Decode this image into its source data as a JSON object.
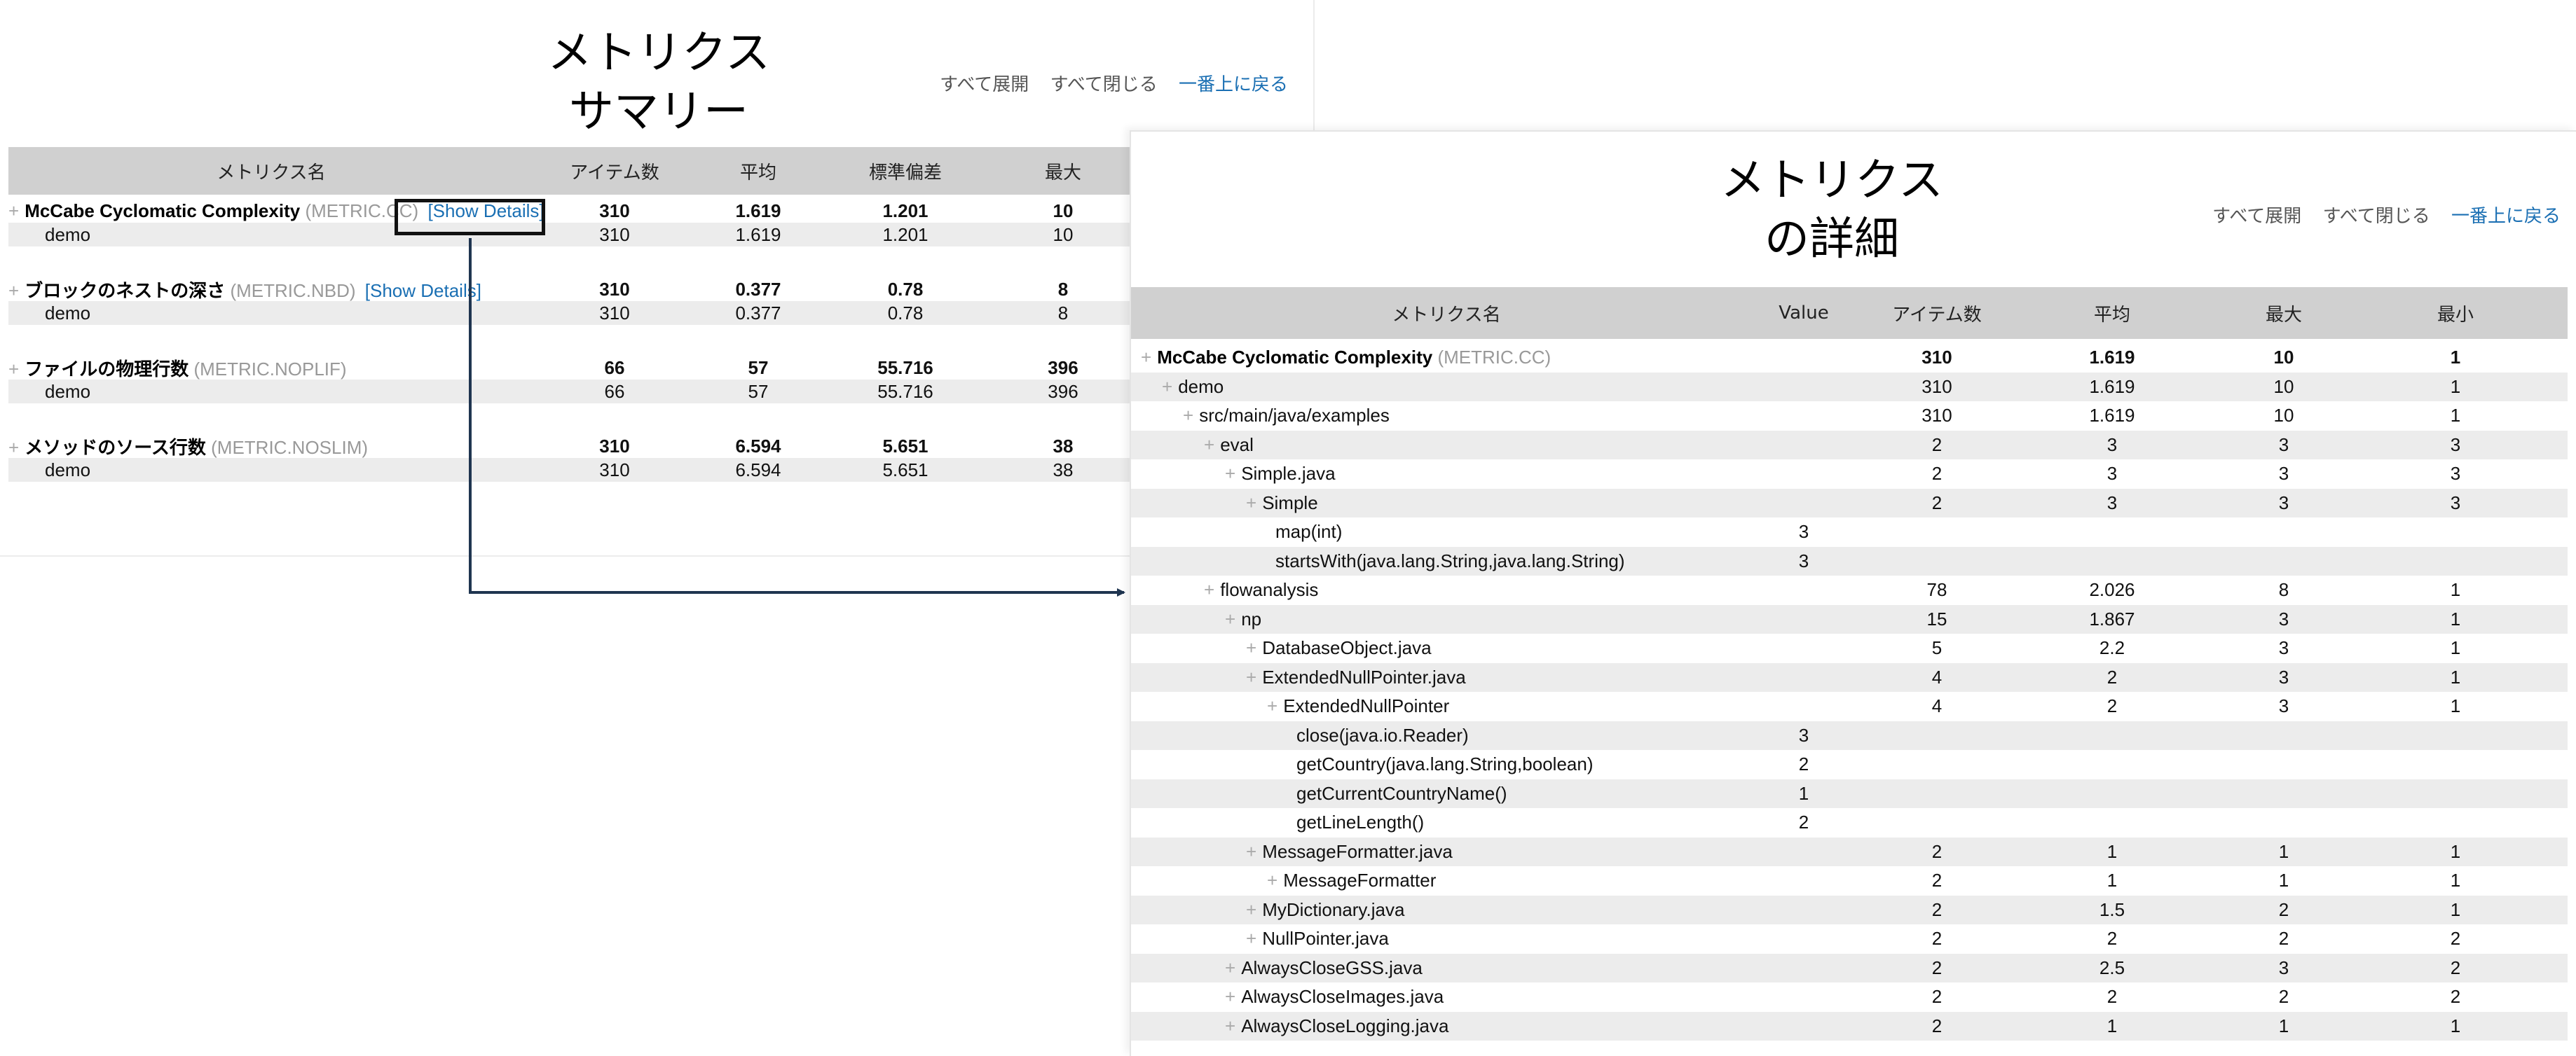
{
  "summary": {
    "title_line1": "メトリクス",
    "title_line2": "サマリー",
    "nav": {
      "expand_all": "すべて展開",
      "collapse_all": "すべて閉じる",
      "back_to_top": "一番上に戻る"
    },
    "headers": {
      "name": "メトリクス名",
      "items": "アイテム数",
      "avg": "平均",
      "std": "標準偏差",
      "max": "最大"
    },
    "show_details_label": "[Show Details]",
    "metrics": [
      {
        "name": "McCabe Cyclomatic Complexity",
        "code": "(METRIC.CC)",
        "items": "310",
        "avg": "1.619",
        "std": "1.201",
        "max": "10",
        "child": {
          "name": "demo",
          "items": "310",
          "avg": "1.619",
          "std": "1.201",
          "max": "10"
        }
      },
      {
        "name": "ブロックのネストの深さ",
        "code": "(METRIC.NBD)",
        "items": "310",
        "avg": "0.377",
        "std": "0.78",
        "max": "8",
        "child": {
          "name": "demo",
          "items": "310",
          "avg": "0.377",
          "std": "0.78",
          "max": "8"
        }
      },
      {
        "name": "ファイルの物理行数",
        "code": "(METRIC.NOPLIF)",
        "items": "66",
        "avg": "57",
        "std": "55.716",
        "max": "396",
        "child": {
          "name": "demo",
          "items": "66",
          "avg": "57",
          "std": "55.716",
          "max": "396"
        }
      },
      {
        "name": "メソッドのソース行数",
        "code": "(METRIC.NOSLIM)",
        "items": "310",
        "avg": "6.594",
        "std": "5.651",
        "max": "38",
        "child": {
          "name": "demo",
          "items": "310",
          "avg": "6.594",
          "std": "5.651",
          "max": "38"
        }
      }
    ]
  },
  "detail": {
    "title_line1": "メトリクス",
    "title_line2": "の詳細",
    "nav": {
      "expand_all": "すべて展開",
      "collapse_all": "すべて閉じる",
      "back_to_top": "一番上に戻る"
    },
    "headers": {
      "name": "メトリクス名",
      "value": "Value",
      "items": "アイテム数",
      "avg": "平均",
      "max": "最大",
      "min": "最小"
    },
    "metric_name": "McCabe Cyclomatic Complexity",
    "metric_code": "(METRIC.CC)",
    "metric_items": "310",
    "metric_avg": "1.619",
    "metric_max": "10",
    "metric_min": "1",
    "rows": [
      {
        "label": "demo",
        "depth": 1,
        "expandable": true,
        "value": "",
        "items": "310",
        "avg": "1.619",
        "max": "10",
        "min": "1"
      },
      {
        "label": "src/main/java/examples",
        "depth": 2,
        "expandable": true,
        "value": "",
        "items": "310",
        "avg": "1.619",
        "max": "10",
        "min": "1"
      },
      {
        "label": "eval",
        "depth": 3,
        "expandable": true,
        "value": "",
        "items": "2",
        "avg": "3",
        "max": "3",
        "min": "3"
      },
      {
        "label": "Simple.java",
        "depth": 4,
        "expandable": true,
        "value": "",
        "items": "2",
        "avg": "3",
        "max": "3",
        "min": "3"
      },
      {
        "label": "Simple",
        "depth": 5,
        "expandable": true,
        "value": "",
        "items": "2",
        "avg": "3",
        "max": "3",
        "min": "3"
      },
      {
        "label": "map(int)",
        "depth": 6,
        "expandable": false,
        "value": "3",
        "items": "",
        "avg": "",
        "max": "",
        "min": ""
      },
      {
        "label": "startsWith(java.lang.String,java.lang.String)",
        "depth": 6,
        "expandable": false,
        "value": "3",
        "items": "",
        "avg": "",
        "max": "",
        "min": ""
      },
      {
        "label": "flowanalysis",
        "depth": 3,
        "expandable": true,
        "value": "",
        "items": "78",
        "avg": "2.026",
        "max": "8",
        "min": "1"
      },
      {
        "label": "np",
        "depth": 4,
        "expandable": true,
        "value": "",
        "items": "15",
        "avg": "1.867",
        "max": "3",
        "min": "1"
      },
      {
        "label": "DatabaseObject.java",
        "depth": 5,
        "expandable": true,
        "value": "",
        "items": "5",
        "avg": "2.2",
        "max": "3",
        "min": "1"
      },
      {
        "label": "ExtendedNullPointer.java",
        "depth": 5,
        "expandable": true,
        "value": "",
        "items": "4",
        "avg": "2",
        "max": "3",
        "min": "1"
      },
      {
        "label": "ExtendedNullPointer",
        "depth": 6,
        "expandable": true,
        "value": "",
        "items": "4",
        "avg": "2",
        "max": "3",
        "min": "1"
      },
      {
        "label": "close(java.io.Reader)",
        "depth": 7,
        "expandable": false,
        "value": "3",
        "items": "",
        "avg": "",
        "max": "",
        "min": ""
      },
      {
        "label": "getCountry(java.lang.String,boolean)",
        "depth": 7,
        "expandable": false,
        "value": "2",
        "items": "",
        "avg": "",
        "max": "",
        "min": ""
      },
      {
        "label": "getCurrentCountryName()",
        "depth": 7,
        "expandable": false,
        "value": "1",
        "items": "",
        "avg": "",
        "max": "",
        "min": ""
      },
      {
        "label": "getLineLength()",
        "depth": 7,
        "expandable": false,
        "value": "2",
        "items": "",
        "avg": "",
        "max": "",
        "min": ""
      },
      {
        "label": "MessageFormatter.java",
        "depth": 5,
        "expandable": true,
        "value": "",
        "items": "2",
        "avg": "1",
        "max": "1",
        "min": "1"
      },
      {
        "label": "MessageFormatter",
        "depth": 6,
        "expandable": true,
        "value": "",
        "items": "2",
        "avg": "1",
        "max": "1",
        "min": "1"
      },
      {
        "label": "MyDictionary.java",
        "depth": 5,
        "expandable": true,
        "value": "",
        "items": "2",
        "avg": "1.5",
        "max": "2",
        "min": "1"
      },
      {
        "label": "NullPointer.java",
        "depth": 5,
        "expandable": true,
        "value": "",
        "items": "2",
        "avg": "2",
        "max": "2",
        "min": "2"
      },
      {
        "label": "AlwaysCloseGSS.java",
        "depth": 4,
        "expandable": true,
        "value": "",
        "items": "2",
        "avg": "2.5",
        "max": "3",
        "min": "2"
      },
      {
        "label": "AlwaysCloseImages.java",
        "depth": 4,
        "expandable": true,
        "value": "",
        "items": "2",
        "avg": "2",
        "max": "2",
        "min": "2"
      },
      {
        "label": "AlwaysCloseLogging.java",
        "depth": 4,
        "expandable": true,
        "value": "",
        "items": "2",
        "avg": "1",
        "max": "1",
        "min": "1"
      }
    ]
  }
}
